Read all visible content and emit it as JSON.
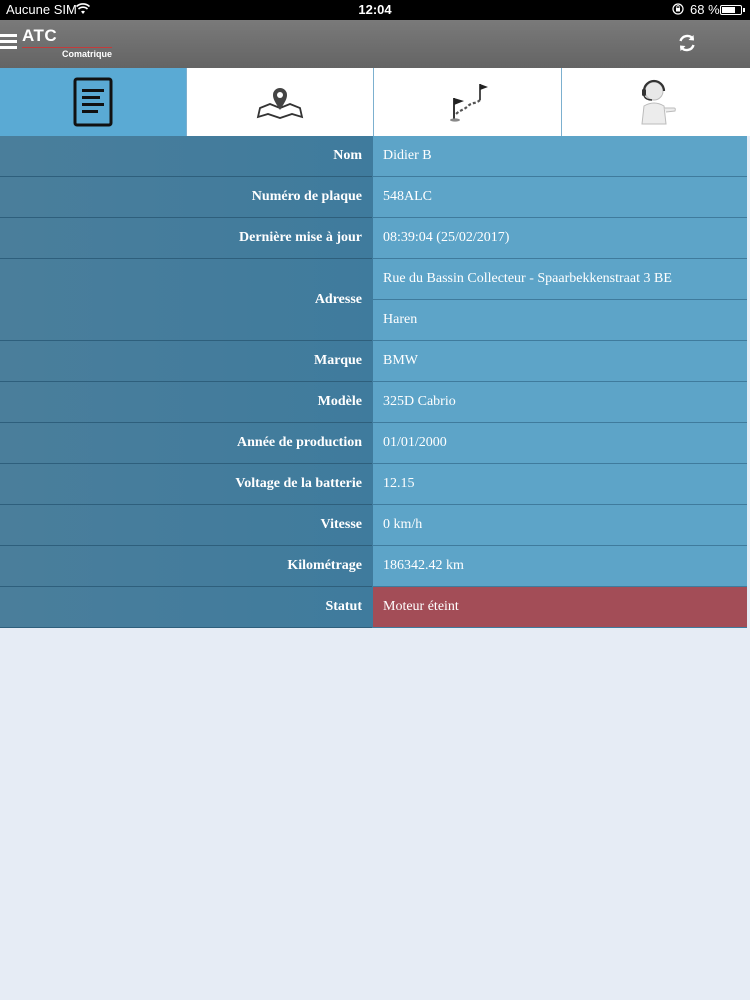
{
  "status_bar": {
    "carrier": "Aucune SIM",
    "time": "12:04",
    "battery_percent": "68 %",
    "battery_level": 0.68
  },
  "app_bar": {
    "logo_main": "ATC",
    "logo_sub": "Comatrique",
    "icons": [
      "menu-icon",
      "refresh-icon"
    ]
  },
  "tabs": [
    {
      "icon": "document-icon",
      "active": true
    },
    {
      "icon": "map-pin-icon",
      "active": false
    },
    {
      "icon": "route-flag-icon",
      "active": false
    },
    {
      "icon": "support-agent-icon",
      "active": false
    }
  ],
  "colors": {
    "header": "#6e6e6e",
    "tab_active": "#5aaad4",
    "label_bg": "#437d9c",
    "value_bg": "#5da4c8",
    "status_bg": "#a34d57",
    "page_bg": "#e6ecf5"
  },
  "details": {
    "nom": {
      "label": "Nom",
      "value": "Didier B"
    },
    "plaque": {
      "label": "Numéro de plaque",
      "value": "548ALC"
    },
    "maj": {
      "label": "Dernière mise à jour",
      "value": "08:39:04 (25/02/2017)"
    },
    "adresse": {
      "label": "Adresse",
      "line1": "Rue du Bassin Collecteur - Spaarbekkenstraat 3 BE",
      "line2": "Haren"
    },
    "marque": {
      "label": "Marque",
      "value": "BMW"
    },
    "modele": {
      "label": "Modèle",
      "value": "325D Cabrio"
    },
    "annee": {
      "label": "Année de production",
      "value": "01/01/2000"
    },
    "voltage": {
      "label": "Voltage de la batterie",
      "value": "12.15"
    },
    "vitesse": {
      "label": "Vitesse",
      "value": "0 km/h"
    },
    "km": {
      "label": "Kilométrage",
      "value": "186342.42 km"
    },
    "statut": {
      "label": "Statut",
      "value": "Moteur éteint"
    }
  }
}
